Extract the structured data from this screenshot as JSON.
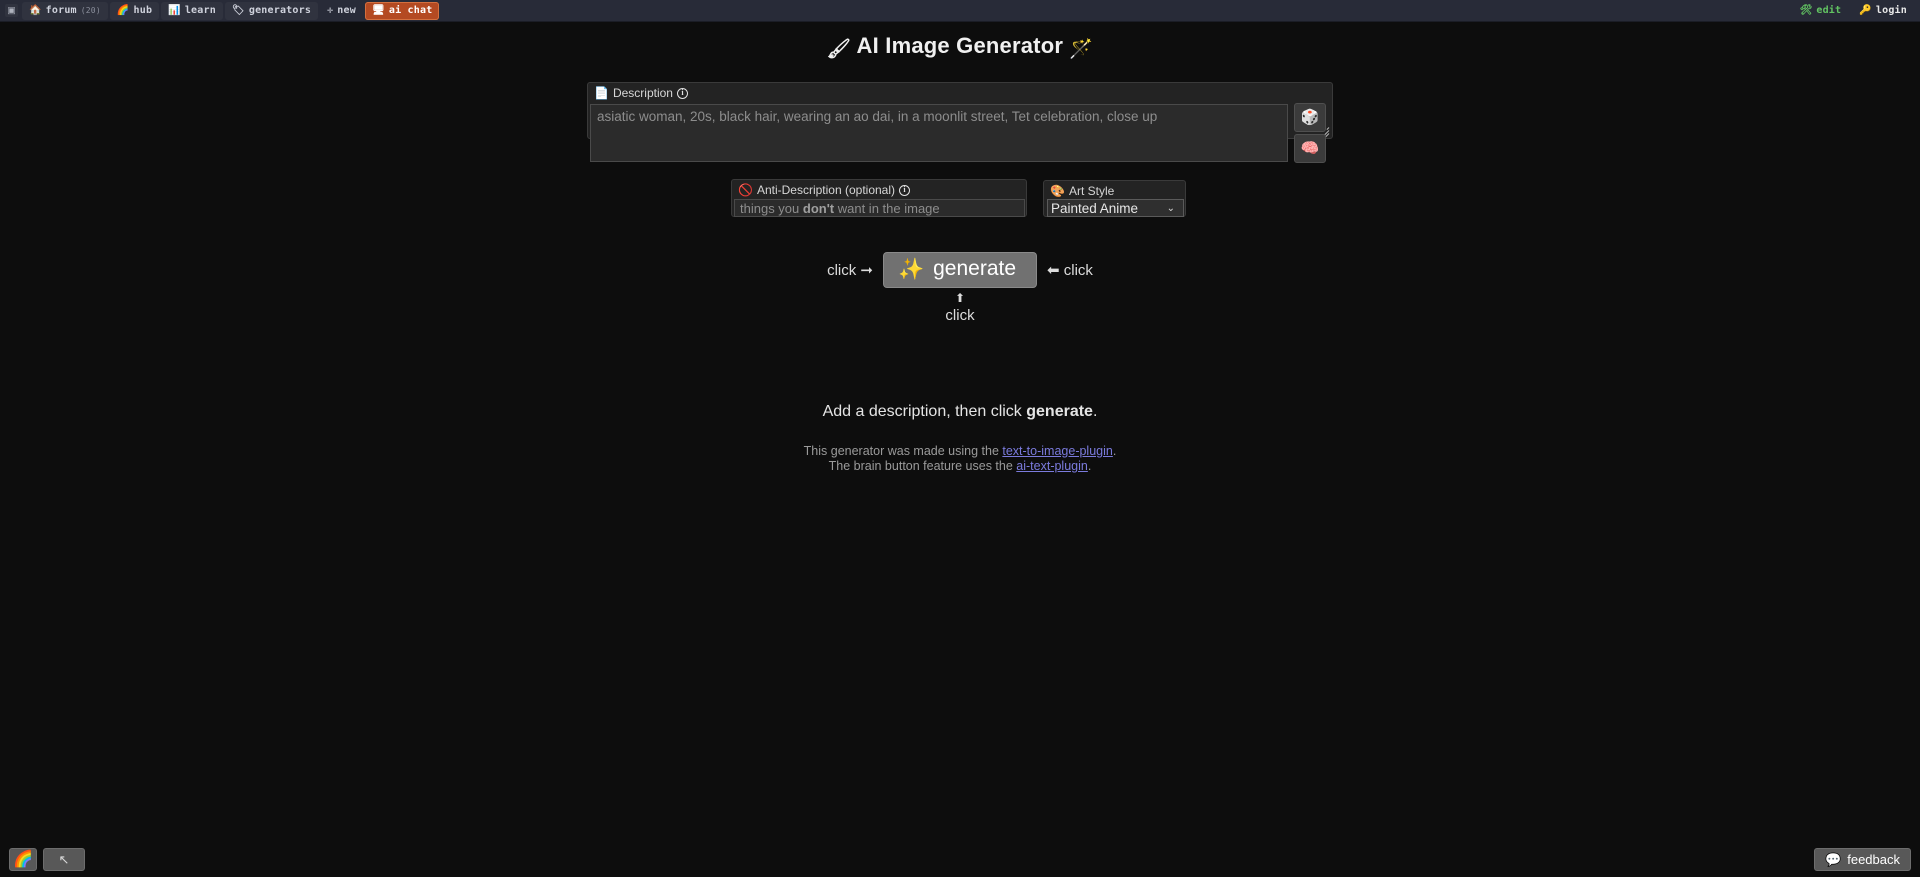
{
  "topbar": {
    "grid_icon": "▣",
    "left_items": [
      {
        "label": "forum",
        "count": "(20)",
        "icon": "🏠",
        "icon_name": "forum-icon",
        "active": false
      },
      {
        "label": "hub",
        "count": "",
        "icon": "🌈",
        "icon_name": "hub-icon",
        "active": false
      },
      {
        "label": "learn",
        "count": "",
        "icon": "📊",
        "icon_name": "learn-icon",
        "active": false
      },
      {
        "label": "generators",
        "count": "",
        "icon": "🏷",
        "icon_name": "generators-icon",
        "active": false
      },
      {
        "label": "new",
        "count": "",
        "icon": "✛",
        "icon_name": "plus-icon",
        "active": false
      },
      {
        "label": "ai chat",
        "count": "",
        "icon": "🖥",
        "icon_name": "ai-chat-icon",
        "active": true
      }
    ],
    "right_items": [
      {
        "label": "edit",
        "icon": "🛠",
        "icon_name": "tools-icon"
      },
      {
        "label": "login",
        "icon": "🔑",
        "icon_name": "key-icon"
      }
    ]
  },
  "page": {
    "title": "AI Image Generator",
    "title_icon_left": "🖌",
    "title_icon_right": "🪄"
  },
  "description": {
    "label": "Description",
    "label_icon": "📄",
    "info_glyph": "i",
    "placeholder": "asiatic woman, 20s, black hair, wearing an ao dai, in a moonlit street, Tet celebration, close up",
    "value": ""
  },
  "side_buttons": {
    "dice": {
      "icon": "🎲",
      "name": "random-prompt-button"
    },
    "brain": {
      "icon": "🧠",
      "name": "ai-brain-button"
    }
  },
  "anti_description": {
    "label": "Anti-Description (optional)",
    "label_icon": "🚫",
    "info_glyph": "i",
    "placeholder_pre": "things you ",
    "placeholder_bold": "don't",
    "placeholder_post": " want in the image",
    "value": ""
  },
  "art_style": {
    "label": "Art Style",
    "label_icon": "🎨",
    "selected": "Painted Anime",
    "caret": "⌄",
    "options": [
      "Painted Anime"
    ]
  },
  "generate": {
    "button_label": "generate",
    "button_icon": "✨",
    "hint_left": "click ➞",
    "hint_right": "⬅ click",
    "hint_below_arrow": "⬆",
    "hint_below": "click"
  },
  "status": {
    "text_pre": "Add a description, then click ",
    "text_bold": "generate",
    "text_post": "."
  },
  "credits": {
    "line1_pre": "This generator was made using the ",
    "line1_link": "text-to-image-plugin",
    "line1_post": ".",
    "line2_pre": "The brain button feature uses the ",
    "line2_link": "ai-text-plugin",
    "line2_post": "."
  },
  "bottom": {
    "theme_button_icon": "🌈",
    "cursor_button_icon": "↖",
    "feedback_label": "feedback",
    "feedback_icon": "💬"
  },
  "colors": {
    "page_bg": "#0d0d0d",
    "navbar_bg": "#282b38",
    "active_nav": "#b44a22",
    "panel_bg": "#232323",
    "input_bg": "#2b2b2b",
    "generate_bg": "#717171",
    "link": "#7b7bdd"
  }
}
